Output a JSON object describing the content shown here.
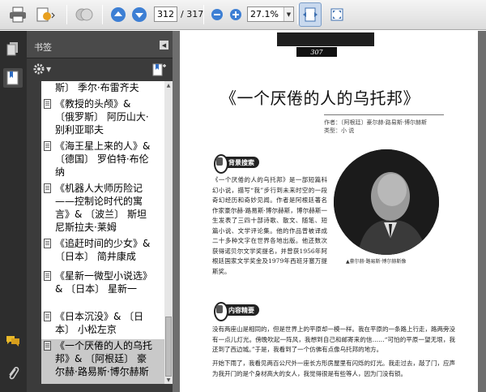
{
  "toolbar": {
    "page_current": "312",
    "page_total": "/ 317",
    "zoom": "27.1%",
    "icons": [
      "printer-icon",
      "export-pdf-icon",
      "collaborate-icon",
      "previous-page-icon",
      "next-page-icon",
      "zoom-out-icon",
      "zoom-in-icon",
      "fit-width-icon",
      "full-screen-icon"
    ]
  },
  "bookmarks_panel": {
    "title": "书签",
    "items": [
      {
        "label": "斯〕 季尔·布雷齐夫"
      },
      {
        "label": "《教授的头颅》& 〔俄罗斯〕 阿历山大·别利亚耶夫"
      },
      {
        "label": "《海王星上来的人》& 〔德国〕 罗伯特·布伦纳"
      },
      {
        "label": "《机器人大师历险记——控制论时代的寓言》& 〔波兰〕 斯坦尼斯拉夫·莱姆"
      },
      {
        "label": "《追赶时间的少女》& 〔日本〕 简井康成"
      },
      {
        "label": "《星新一微型小说选》& 〔日本〕 星新一"
      },
      {
        "label": "《日本沉没》& 〔日本〕 小松左京"
      },
      {
        "label": "《一个厌倦的人的乌托邦》& 〔阿根廷〕 豪尔赫·路易斯·博尔赫斯"
      }
    ]
  },
  "document": {
    "page_number": "307",
    "title": "《一个厌倦的人的乌托邦》",
    "byline_line1": "作者：〔阿根廷〕豪尔赫·路易斯·博尔赫斯",
    "byline_line2": "类型：小 说",
    "section1": "背景搜索",
    "section2": "内容精要",
    "background_text": "《一个厌倦的人的乌托邦》是一部短篇科幻小说，描写“我”步行到未来时空的一段奇幻经历和奇妙见闻。作者是阿根廷著名作家豪尔赫·路易斯·博尔赫斯，博尔赫斯一生发表了三四十部诗歌、散文、随笔、短篇小说、文学评论集。他的作品曾被译成二十多种文字在世界各地出版。他还数次获得诺贝尔文学奖提名，并曾获1956年阿根廷国家文学奖金及1979年西班牙塞万提斯奖。",
    "caption": "▲豪尔赫·路易斯·博尔赫斯像",
    "content_text": "没有两座山是相同的，但是世界上的平原却一模一样。我在平原的一条路上行走，路两旁没有一点儿灯光。傍晚吹起一阵风，我想到自己和邮寄来的信……“可怕的平原一望无垠，我还到了西边城。”于是，我看到了一个仿佛有点像乌托邦的地方。",
    "content_text2": "开始下雨了，我看见两百公尺外一座长方形房屋里有闪烁的灯光。我走过去，敲了门，应声为我开门的是个身材高大的女人，我觉得很是有些等人，因为门没有锁。"
  }
}
